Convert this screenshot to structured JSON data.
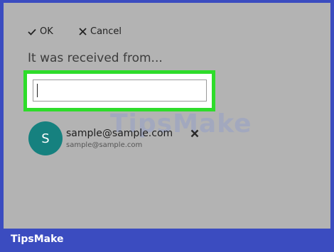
{
  "toolbar": {
    "ok_label": "OK",
    "cancel_label": "Cancel"
  },
  "heading": "It was received from...",
  "search": {
    "value": "",
    "placeholder": ""
  },
  "contact": {
    "avatar_initial": "S",
    "avatar_color": "#16817f",
    "name": "sample@sample.com",
    "email": "sample@sample.com"
  },
  "highlight_color": "#2edc2a",
  "brand": {
    "watermark": "TipsMake",
    "footer": "TipsMake",
    "footer_color": "#3b4cc0"
  },
  "icons": {
    "ok": "check-icon",
    "cancel": "close-icon",
    "remove": "close-icon"
  }
}
